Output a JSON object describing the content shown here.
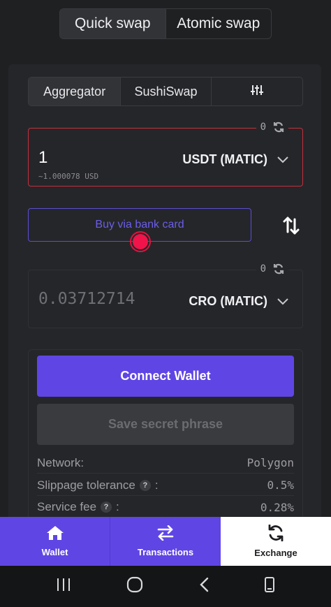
{
  "mode_tabs": [
    {
      "label": "Quick swap",
      "active": true
    },
    {
      "label": "Atomic swap",
      "active": false
    }
  ],
  "source_tabs": [
    {
      "label": "Aggregator",
      "active": true
    },
    {
      "label": "SushiSwap",
      "active": false
    },
    {
      "icon": "settings-sliders-icon"
    }
  ],
  "from": {
    "balance": "0",
    "amount": "1",
    "usd_value": "~1.000078 USD",
    "token": "USDT (MATIC)"
  },
  "buy_button_label": "Buy via bank card",
  "to": {
    "balance": "0",
    "amount_placeholder": "0.03712714",
    "token": "CRO (MATIC)"
  },
  "connect_wallet_label": "Connect Wallet",
  "save_secret_label": "Save secret phrase",
  "info": [
    {
      "label": "Network:",
      "value": "Polygon",
      "help": false
    },
    {
      "label": "Slippage tolerance",
      "suffix": ":",
      "value": "0.5%",
      "help": true
    },
    {
      "label": "Service fee",
      "suffix": ":",
      "value": "0.28%",
      "help": true
    }
  ],
  "help_glyph": "?",
  "bottom_nav": [
    {
      "label": "Wallet",
      "icon": "home-icon",
      "active": false
    },
    {
      "label": "Transactions",
      "icon": "arrows-exchange-icon",
      "active": false
    },
    {
      "label": "Exchange",
      "icon": "refresh-icon",
      "active": true
    }
  ],
  "system_nav": [
    "recent-apps-icon",
    "home-circle-icon",
    "back-icon",
    "rotate-phone-icon"
  ],
  "colors": {
    "accent": "#6045e5",
    "error_border": "#c4303b",
    "background": "#1f2022"
  }
}
